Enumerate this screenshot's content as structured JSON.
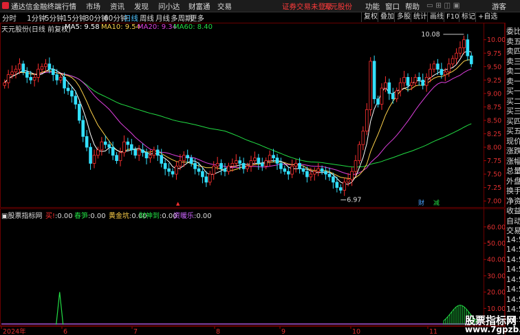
{
  "topbar": {
    "app_name": "通达信金融终端",
    "menus": [
      "行情",
      "市场",
      "资讯",
      "发现",
      "问小达",
      "财富通",
      "交易"
    ],
    "notice": "证券交易未登录",
    "stock_name": "天元股份",
    "right_items": [
      "功能",
      "窗口",
      "帮助"
    ],
    "user": "游客"
  },
  "periodbar": {
    "periods": [
      "分时",
      "1分钟",
      "5分钟",
      "15分钟",
      "30分钟",
      "60分钟",
      "日线",
      "周线",
      "月线",
      "多周期",
      "更多"
    ],
    "active": "日线",
    "tools": [
      "复权",
      "叠加",
      "多股",
      "统计",
      "画线",
      "F10",
      "标记",
      "+自选"
    ]
  },
  "main_chart": {
    "title": "天元股份(日线 前复权)",
    "ma_labels": [
      {
        "label": "MA5: 9.58",
        "color": "#ffffff"
      },
      {
        "label": "MA10: 9.54",
        "color": "#ffd24a"
      },
      {
        "label": "MA20: 9.34",
        "color": "#e040e0"
      },
      {
        "label": "MA60: 8.40",
        "color": "#22dd44"
      }
    ],
    "high_label": "10.08",
    "low_label": "6.97",
    "event_markers": [
      {
        "text": "财",
        "color": "#4aa3ff"
      },
      {
        "text": "减",
        "color": "#22dd44"
      }
    ],
    "y_ticks": [
      "10.00",
      "9.75",
      "9.50",
      "9.25",
      "9.00",
      "8.75",
      "8.50",
      "8.25",
      "8.00",
      "7.75",
      "7.50",
      "7.25",
      "7.00"
    ]
  },
  "indicator": {
    "name": "股票指标网",
    "items": [
      {
        "label": "买!",
        "value": "0.00",
        "color": "#ff3030"
      },
      {
        "label": "春笋",
        "value": "0.00",
        "color": "#22dd44"
      },
      {
        "label": "黄金坑",
        "value": "0.00",
        "color": "#ffd24a"
      },
      {
        "label": "财神到",
        "value": "0.00",
        "color": "#22dd44"
      },
      {
        "label": "资暖乐",
        "value": "0.00",
        "color": "#cc66ff"
      }
    ],
    "y_ticks": [
      "60.00",
      "50.00",
      "40.00",
      "30.00",
      "20.00",
      "10.00"
    ]
  },
  "xaxis": {
    "labels": [
      "2024年",
      "6",
      "7",
      "8",
      "9",
      "10",
      "11"
    ]
  },
  "sidebar": {
    "items": [
      "委比",
      "卖五",
      "卖四",
      "卖三",
      "卖二",
      "卖一",
      "买一",
      "买二",
      "买三",
      "买四",
      "买五",
      "现价",
      "涨跌",
      "涨幅",
      "总量",
      "外盘",
      "换手",
      "净资",
      "收益",
      "自动",
      "交易",
      "14:5",
      "14:5",
      "14:5",
      "14:5",
      "14:5",
      "14:5",
      "14:5",
      "14:5",
      "14:5"
    ]
  },
  "watermark": {
    "title": "股票指标网",
    "url": "www.7gpzb.com"
  },
  "chart_data": {
    "type": "candlestick",
    "y_range": [
      6.9,
      10.15
    ],
    "candles_close": [
      9.2,
      9.35,
      9.4,
      9.45,
      9.55,
      9.4,
      9.3,
      9.25,
      9.3,
      9.45,
      9.5,
      9.55,
      9.45,
      9.35,
      9.25,
      9.3,
      9.1,
      9.05,
      8.95,
      8.8,
      8.5,
      8.2,
      8.0,
      7.7,
      7.85,
      7.95,
      8.1,
      8.05,
      8.0,
      7.85,
      7.75,
      7.9,
      8.1,
      8.05,
      7.95,
      7.85,
      7.95,
      7.9,
      7.8,
      7.85,
      7.95,
      7.85,
      7.7,
      7.6,
      7.55,
      7.5,
      7.65,
      7.75,
      7.85,
      7.8,
      7.7,
      7.6,
      7.55,
      7.45,
      7.35,
      7.5,
      7.65,
      7.7,
      7.6,
      7.55,
      7.65,
      7.7,
      7.75,
      7.7,
      7.6,
      7.65,
      7.75,
      7.8,
      7.7,
      7.65,
      7.75,
      7.85,
      7.8,
      7.7,
      7.6,
      7.55,
      7.5,
      7.65,
      7.7,
      7.6,
      7.55,
      7.45,
      7.5,
      7.55,
      7.6,
      7.55,
      7.5,
      7.45,
      7.35,
      7.25,
      7.2,
      7.35,
      7.4,
      7.55,
      7.75,
      8.05,
      8.3,
      8.7,
      9.6,
      8.9,
      8.8,
      9.1,
      9.2,
      9.0,
      8.9,
      9.05,
      9.2,
      9.3,
      9.15,
      9.2,
      9.3,
      9.25,
      9.15,
      9.3,
      9.45,
      9.55,
      9.45,
      9.35,
      9.4,
      9.55,
      9.65,
      9.75,
      9.85,
      10.0,
      9.7,
      9.55
    ],
    "ma60_end": 8.4,
    "indicator_spikes": [
      {
        "label": "春笋",
        "approx_index": 14,
        "value": 20
      },
      {
        "label": "春笋",
        "approx_index": 122,
        "value": 12
      }
    ]
  }
}
